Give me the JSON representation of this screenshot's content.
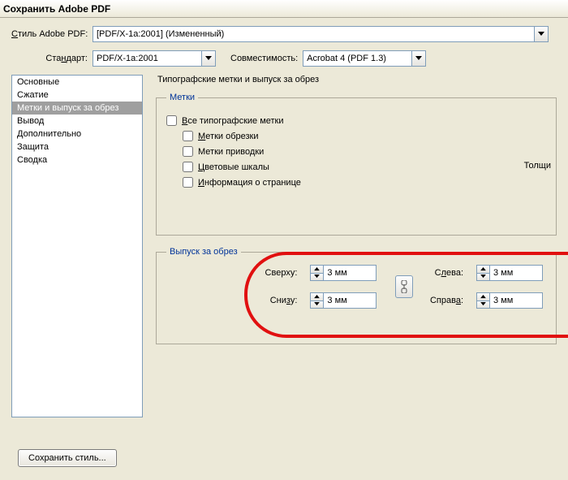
{
  "window_title": "Сохранить Adobe PDF",
  "style_row": {
    "label": "Стиль Adobe PDF:",
    "label_underline": "С",
    "value": "[PDF/X-1a:2001] (Измененный)"
  },
  "standard_row": {
    "label": "Стандарт:",
    "label_underline": "н",
    "value": "PDF/X-1a:2001"
  },
  "compat_row": {
    "label": "Совместимость:",
    "value": "Acrobat 4 (PDF 1.3)"
  },
  "sidebar": {
    "items": [
      "Основные",
      "Сжатие",
      "Метки и выпуск за обрез",
      "Вывод",
      "Дополнительно",
      "Защита",
      "Сводка"
    ],
    "selected_index": 2
  },
  "content": {
    "title": "Типографские метки и выпуск за обрез",
    "marks_group": {
      "legend": "Метки",
      "all": "Все типографские метки",
      "items": [
        "Метки обрезки",
        "Метки приводки",
        "Цветовые шкалы",
        "Информация о странице"
      ],
      "cutoff_right": "Толщи"
    },
    "bleed_group": {
      "legend": "Выпуск за обрез",
      "top_label": "Сверху:",
      "bottom_label": "Снизу:",
      "left_label": "Слева:",
      "right_label": "Справа:",
      "value": "3 мм"
    }
  },
  "save_style_button": "Сохранить стиль..."
}
